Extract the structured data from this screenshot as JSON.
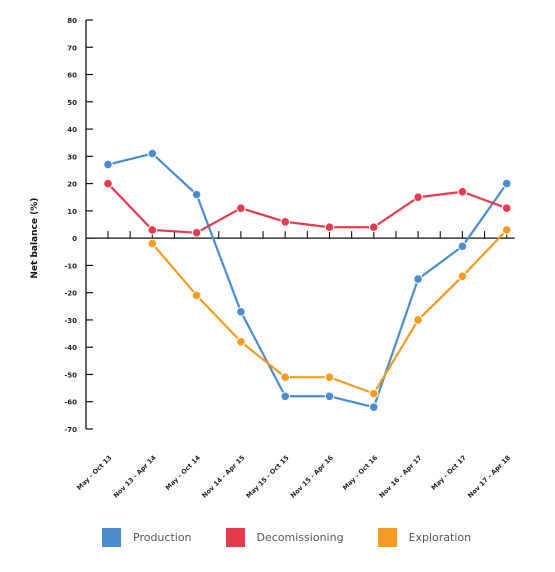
{
  "chart_data": {
    "type": "line",
    "title": "",
    "xlabel": "",
    "ylabel": "Net balance (%)",
    "ylim": [
      -70,
      80
    ],
    "yticks": [
      80,
      70,
      60,
      50,
      40,
      30,
      20,
      10,
      0,
      -10,
      -20,
      -30,
      -40,
      -50,
      -60,
      -70
    ],
    "grid": false,
    "legend_position": "bottom",
    "categories": [
      "May - Oct 13",
      "Nov 13 - Apr 14",
      "May - Oct 14",
      "Nov 14 - Apr 15",
      "May 15 - Oct 15",
      "Nov 15 - Apr 16",
      "May - Oct 16",
      "Nov 16 - Apr 17",
      "May - Oct 17",
      "Nov 17 - Apr 18"
    ],
    "series": [
      {
        "name": "Production",
        "color": "#4a8ccc",
        "values": [
          27,
          31,
          16,
          -27,
          -58,
          -58,
          -62,
          -15,
          -3,
          20
        ]
      },
      {
        "name": "Decomissioning",
        "color": "#e63a4e",
        "values": [
          20,
          3,
          2,
          11,
          6,
          4,
          4,
          15,
          17,
          11
        ]
      },
      {
        "name": "Exploration",
        "color": "#f39c1f",
        "values": [
          null,
          -2,
          -21,
          -38,
          -51,
          -51,
          -57,
          -30,
          -14,
          3
        ]
      }
    ]
  }
}
